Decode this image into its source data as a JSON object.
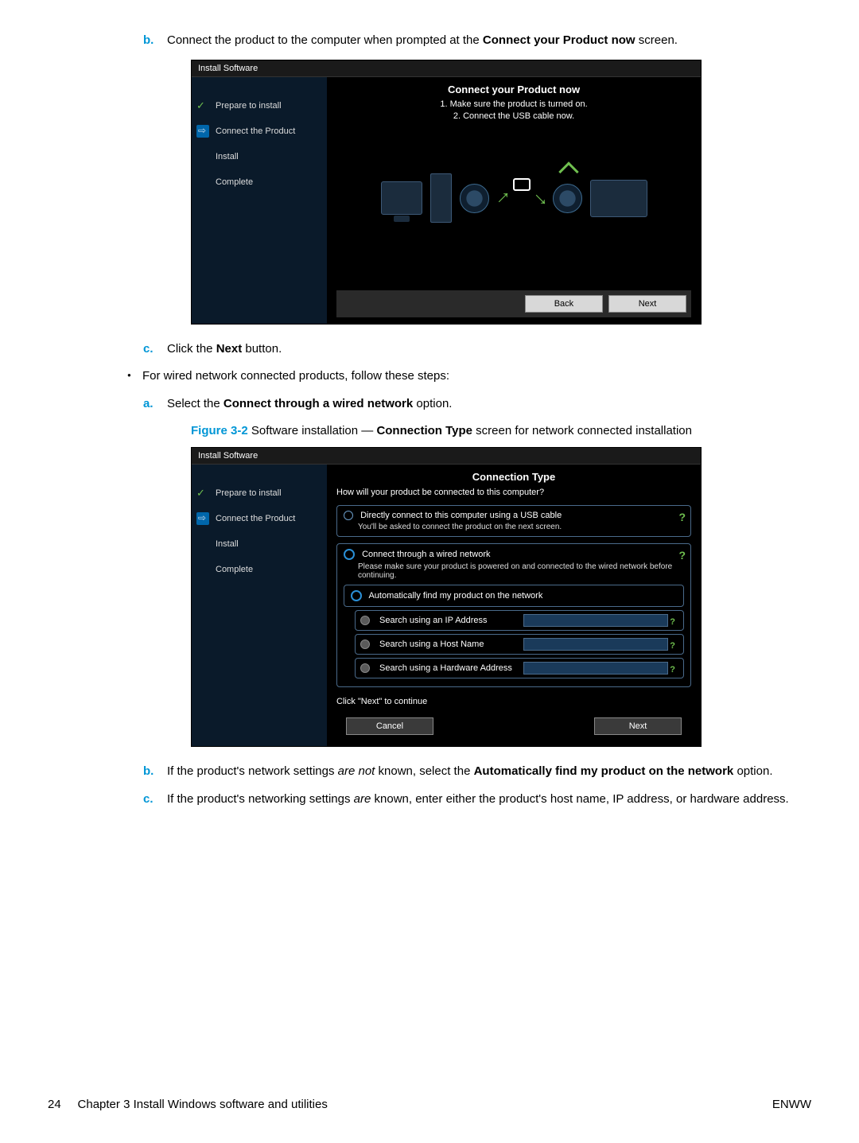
{
  "step_b": {
    "letter": "b.",
    "text_pre": "Connect the product to the computer when prompted at the ",
    "bold1": "Connect your Product now",
    "text_post": " screen."
  },
  "fig1": {
    "header": "Install Software",
    "sidebar": [
      "Prepare to install",
      "Connect the Product",
      "Install",
      "Complete"
    ],
    "main_title": "Connect your Product now",
    "line1": "1. Make sure the product is turned on.",
    "line2": "2. Connect the USB cable now.",
    "back": "Back",
    "next": "Next"
  },
  "step_c": {
    "letter": "c.",
    "pre": "Click the ",
    "bold": "Next",
    "post": " button."
  },
  "bullet1": "For wired network connected products, follow these steps:",
  "step_a2": {
    "letter": "a.",
    "pre": "Select the ",
    "bold": "Connect through a wired network",
    "post": " option."
  },
  "figcaption": {
    "label": "Figure 3-2",
    "pre": "  Software installation — ",
    "bold": "Connection Type",
    "post": " screen for network connected installation"
  },
  "fig2": {
    "header": "Install Software",
    "sidebar": [
      "Prepare to install",
      "Connect the Product",
      "Install",
      "Complete"
    ],
    "title": "Connection Type",
    "subtitle": "How will your product be connected to this computer?",
    "opt1_main": "Directly connect to this computer using a USB cable",
    "opt1_sub": "You'll be asked to connect the product on the next screen.",
    "opt2_main": "Connect through a wired network",
    "opt2_sub": "Please make sure your product is powered on and connected to the wired network before continuing.",
    "opt3_main": "Automatically find my product on the network",
    "search_ip": "Search using an IP Address",
    "search_host": "Search using a Host Name",
    "search_hw": "Search using a Hardware Address",
    "hint": "Click \"Next\" to continue",
    "cancel": "Cancel",
    "next": "Next"
  },
  "step_b2": {
    "letter": "b.",
    "pre": "If the product's network settings ",
    "ital": "are not",
    "mid": " known, select the ",
    "bold": "Automatically find my product on the network",
    "post": " option."
  },
  "step_c2": {
    "letter": "c.",
    "pre": "If the product's networking settings ",
    "ital": "are",
    "post": " known, enter either the product's host name, IP address, or hardware address."
  },
  "footer": {
    "page": "24",
    "chapter": "Chapter 3   Install Windows software and utilities",
    "right": "ENWW"
  }
}
